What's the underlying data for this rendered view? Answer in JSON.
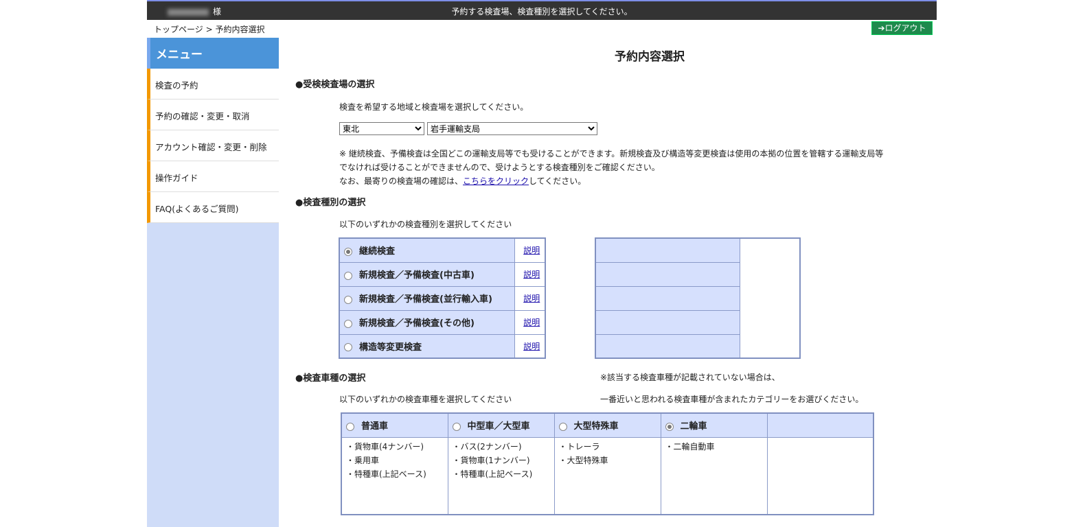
{
  "header": {
    "honorific": "様",
    "message": "予約する検査場、検査種別を選択してください。"
  },
  "breadcrumb": "トップページ > 予約内容選択",
  "logout": "➔ログアウト",
  "sidebar": {
    "title": "メニュー",
    "items": [
      "検査の予約",
      "予約の確認・変更・取消",
      "アカウント確認・変更・削除",
      "操作ガイド",
      "FAQ(よくあるご質問)"
    ]
  },
  "page_title": "予約内容選択",
  "section1": {
    "heading": "●受検検査場の選択",
    "instruction": "検査を希望する地域と検査場を選択してください。",
    "region": "東北",
    "office": "岩手運輸支局",
    "note1": "※ 継続検査、予備検査は全国どこの運輸支局等でも受けることができます。新規検査及び構造等変更検査は使用の本拠の位置を管轄する運輸支局等",
    "note2": "でなければ受けることができませんので、受けようとする検査種別をご確認ください。",
    "note3_pre": "なお、最寄りの検査場の確認は、",
    "note3_link": "こちらをクリック",
    "note3_post": "してください。"
  },
  "section2": {
    "heading": "●検査種別の選択",
    "instruction": "以下のいずれかの検査種別を選択してください",
    "explain": "説明",
    "options": [
      {
        "label": "継続検査",
        "selected": true
      },
      {
        "label": "新規検査／予備検査(中古車)",
        "selected": false
      },
      {
        "label": "新規検査／予備検査(並行輸入車)",
        "selected": false
      },
      {
        "label": "新規検査／予備検査(その他)",
        "selected": false
      },
      {
        "label": "構造等変更検査",
        "selected": false
      }
    ]
  },
  "section3": {
    "heading": "●検査車種の選択",
    "instruction": "以下のいずれかの検査車種を選択してください",
    "note1": "※該当する検査車種が記載されていない場合は、",
    "note2": "一番近いと思われる検査車種が含まれたカテゴリーをお選びください。",
    "types": [
      {
        "label": "普通車",
        "items": [
          "・貨物車(4ナンバー)",
          "・乗用車",
          "・特種車(上記ベース)"
        ]
      },
      {
        "label": "中型車／大型車",
        "items": [
          "・バス(2ナンバー)",
          "・貨物車(1ナンバー)",
          "・特種車(上記ベース)"
        ]
      },
      {
        "label": "大型特殊車",
        "items": [
          "・トレーラ",
          "・大型特殊車"
        ]
      },
      {
        "label": "二輪車",
        "items": [
          "・二輪自動車"
        ]
      }
    ]
  }
}
